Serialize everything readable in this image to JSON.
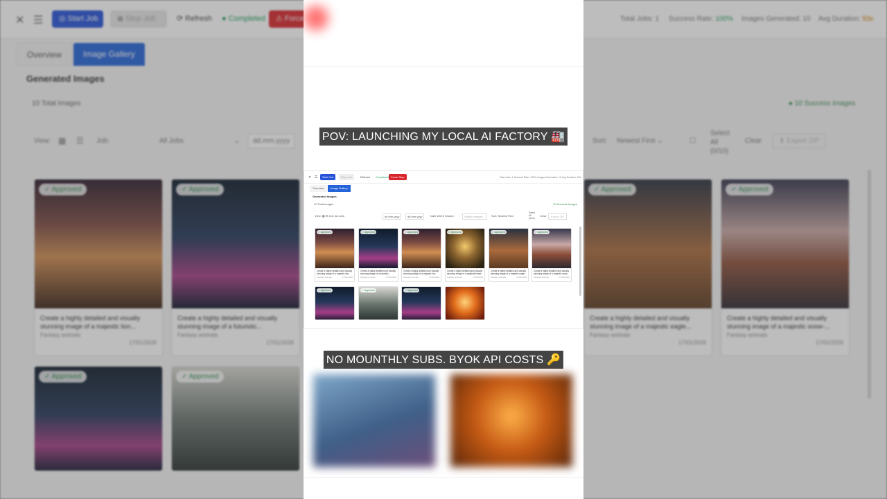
{
  "background_app": {
    "close_icon": "close-icon",
    "menu_icon": "hamburger-icon",
    "toolbar": {
      "start_label": "Start Job",
      "stop_label": "Stop Job",
      "refresh_label": "Refresh",
      "completed_label": "Completed",
      "force_label": "Force"
    },
    "stats": {
      "total_jobs": "Total Jobs: 1",
      "success_rate_label": "Success Rate: ",
      "success_rate_value": "100%",
      "images_generated": "Images Generated: 10",
      "avg_duration_label": "Avg Duration: ",
      "avg_duration_value": "93s"
    },
    "tabs": {
      "overview": "Overview",
      "gallery": "Image Gallery"
    },
    "section_title": "Generated Images",
    "total_images": "10 Total Images",
    "success_images": "10 Success Images",
    "filters": {
      "view_label": "View:",
      "job_label": "Job:",
      "job_value": "All Jobs",
      "date_placeholder": "dd.mm.yyyy",
      "sort_label": "Sort:",
      "sort_value": "Newest First",
      "select_all": "Select All (0/10)",
      "clear": "Clear",
      "export": "Export ZIP"
    },
    "cards": [
      {
        "badge": "✓ Approved",
        "desc": "Create a highly detailed and visually stunning image of a majestic lion...",
        "cat": "Fantasy animals",
        "date": "17/01/2026"
      },
      {
        "badge": "✓ Approved",
        "desc": "Create a highly detailed and visually stunning image of a futuristic...",
        "cat": "Fantasy animals",
        "date": "17/01/2026"
      },
      {
        "badge": "✓ Approved",
        "desc": "Create a highly detailed and visually stunning image of a majestic eagle...",
        "cat": "Fantasy animals",
        "date": "17/01/2026"
      },
      {
        "badge": "✓ Approved",
        "desc": "Create a highly detailed and visually stunning image of a majestic snow-...",
        "cat": "Fantasy animals",
        "date": "17/01/2026"
      },
      {
        "badge": "✓ Approved"
      },
      {
        "badge": "✓ Approved"
      }
    ]
  },
  "captions": {
    "top": "POV: LAUNCHING MY LOCAL AI FACTORY 🏭",
    "bottom": "NO MOUNTHLY SUBS. BYOK API COSTS 🔑"
  },
  "mini": {
    "start": "Start Job",
    "stop": "Stop Job",
    "refresh": "Refresh",
    "completed": "Completed",
    "force": "Force Stop",
    "stats": "Total Jobs: 1   Success Rate: 100%   Images Generated: 10   Avg Duration: 93s",
    "tab_overview": "Overview",
    "tab_gallery": "Image Gallery",
    "title": "Generated Images",
    "total": "10 Total Images",
    "success": "10 Success Images",
    "filters": "View:   ▦ ☰   Job:        All Jobs",
    "date1": "dd.mm.yyyy",
    "date2": "dd.mm.yyyy",
    "filters2": "Date   Week   Search:",
    "search_placeholder": "Search images...",
    "sort": "Sort:   Newest First",
    "select": "Select All (0/10)",
    "clear": "Clear",
    "export": "Export ZIP",
    "cards": [
      {
        "badge": "✓ Approved",
        "desc": "Create a highly detailed and visually stunning image of a majestic lion...",
        "cat": "Fantasy animals",
        "date": "17/01/2026"
      },
      {
        "badge": "✓ Approved",
        "desc": "Create a highly detailed and visually stunning image of a futuristic...",
        "cat": "Fantasy animals",
        "date": "17/01/2026"
      },
      {
        "badge": "✓ Approved",
        "desc": "Create a highly detailed and visually stunning image of a majestic lion...",
        "cat": "Fantasy animals",
        "date": "17/01/2026"
      },
      {
        "badge": "✓ Approved",
        "desc": "Create a highly detailed and visually stunning image of a mystical forest...",
        "cat": "Fantasy animals",
        "date": "17/01/2026"
      },
      {
        "badge": "✓ Approved",
        "desc": "Create a highly detailed and visually stunning image of a majestic eagle...",
        "cat": "Fantasy animals",
        "date": "17/01/2026"
      },
      {
        "badge": "✓ Approved",
        "desc": "Create a highly detailed and visually stunning image of a majestic snow...",
        "cat": "Fantasy animals",
        "date": "17/01/2026"
      },
      {
        "badge": "✓ Approved"
      },
      {
        "badge": "✓ Approved"
      },
      {
        "badge": "✓ Approved"
      },
      {
        "badge": ""
      }
    ]
  }
}
